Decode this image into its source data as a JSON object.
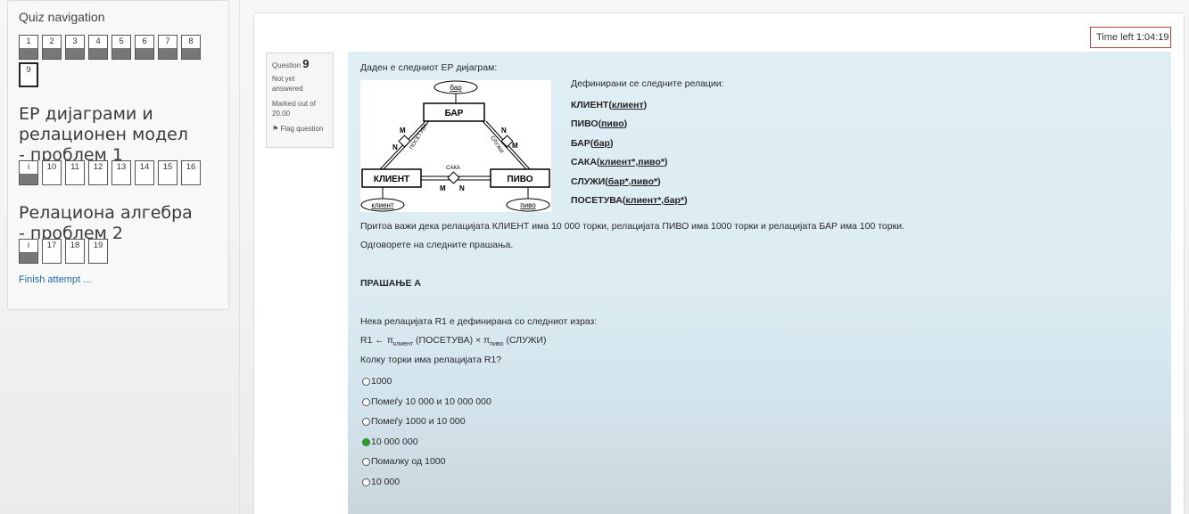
{
  "nav": {
    "title": "Quiz navigation",
    "questions_row1": [
      "1",
      "2",
      "3",
      "4",
      "5",
      "6",
      "7",
      "8"
    ],
    "current_question": "9",
    "section1_title": "ЕР дијаграми и релационен модел - проблем 1",
    "section1_buttons": [
      "i",
      "10",
      "11",
      "12",
      "13",
      "14",
      "15",
      "16"
    ],
    "section2_title": "Релациона алгебра - проблем 2",
    "section2_buttons": [
      "i",
      "17",
      "18",
      "19"
    ],
    "finish_label": "Finish attempt ..."
  },
  "timer": "Time left 1:04:19",
  "question_info": {
    "label": "Question",
    "number": "9",
    "status": "Not yet answered",
    "marks": "Marked out of 20.00",
    "flag": "Flag question"
  },
  "content": {
    "intro": "Даден е следниот ЕР дијаграм:",
    "diagram": {
      "entity_bar": "БАР",
      "entity_klient": "КЛИЕНТ",
      "entity_pivo": "ПИВО",
      "attr_bar": "бар",
      "attr_klient": "клиент",
      "attr_pivo": "пиво",
      "rel_poseta": "ПОСЕТУВА",
      "rel_sluzhi": "СЛУЖИ",
      "rel_saka": "САКА",
      "card_m1": "M",
      "card_n1": "N",
      "card_n2": "N",
      "card_m2": "M",
      "card_m3": "M",
      "card_n3": "N"
    },
    "relations_header": "Дефинирани се следните релации:",
    "relations": [
      {
        "name": "КЛИЕНТ(",
        "key": "клиент",
        "end": ")"
      },
      {
        "name": "ПИВО(",
        "key": "пиво",
        "end": ")"
      },
      {
        "name": "БАР(",
        "key": "бар",
        "end": ")"
      },
      {
        "name": "САКА(",
        "key": "клиент*,пиво*",
        "end": ")"
      },
      {
        "name": "СЛУЖИ(",
        "key": "бар*,пиво*",
        "end": ")"
      },
      {
        "name": "ПОСЕТУВА(",
        "key": "клиент*,бар*",
        "end": ")"
      }
    ],
    "paragraph1": "Притоа важи дека релацијата КЛИЕНТ има 10 000 торки, релацијата ПИВО има 1000 торки и релацијата БАР има 100 торки.",
    "paragraph2": "Одговорете на следните прашања.",
    "question_head": "ПРАШАЊЕ А",
    "q_text1": "Нека релацијата R1 е дефинирана со следниот израз:",
    "formula": {
      "prefix": "R1 ← π",
      "sub1": "клиент",
      "mid": " (ПОСЕТУВА) × π",
      "sub2": "пиво",
      "suffix": " (СЛУЖИ)"
    },
    "q_text2": "Колку торки има релацијата R1?",
    "options": [
      "1000",
      "Помеѓу 10 000 и 10 000 000",
      "Помеѓу 1000 и 10 000",
      "10 000 000",
      "Помалку од 1000",
      "10 000"
    ],
    "selected_option": "10 000 000"
  }
}
